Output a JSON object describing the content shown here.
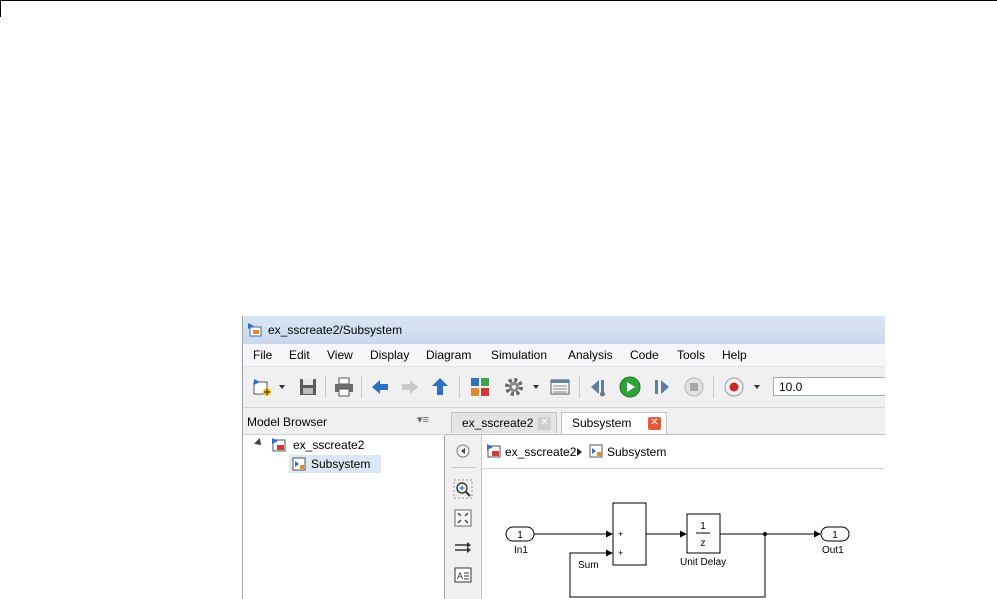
{
  "window": {
    "title": "ex_sscreate2/Subsystem"
  },
  "menu": [
    "File",
    "Edit",
    "View",
    "Display",
    "Diagram",
    "Simulation",
    "Analysis",
    "Code",
    "Tools",
    "Help"
  ],
  "toolbar": {
    "stop_time": "10.0"
  },
  "model_browser": {
    "title": "Model Browser",
    "menu_glyph": "▾≡",
    "tree": [
      {
        "label": "ex_sscreate2",
        "expanded": true
      },
      {
        "label": "Subsystem",
        "selected": true
      }
    ]
  },
  "tabs": [
    {
      "label": "ex_sscreate2",
      "active": false
    },
    {
      "label": "Subsystem",
      "active": true
    }
  ],
  "address": {
    "root": "ex_sscreate2",
    "child": "Subsystem"
  },
  "diagram": {
    "in1": {
      "number": "1",
      "name": "In1"
    },
    "sum": {
      "name": "Sum",
      "sign1": "+",
      "sign2": "+"
    },
    "delay": {
      "numerator": "1",
      "denominator": "z",
      "name": "Unit Delay"
    },
    "out1": {
      "number": "1",
      "name": "Out1"
    }
  },
  "colors": {
    "close_red": "#e55a3c",
    "play_green": "#2fa33a",
    "record_red": "#cc2a2a",
    "arrow_blue": "#2f6fc2"
  }
}
